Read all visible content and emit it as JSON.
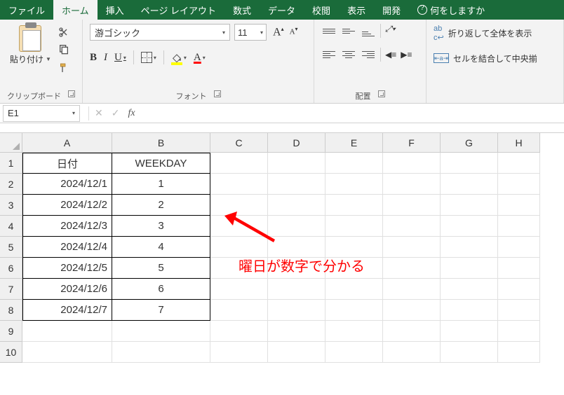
{
  "tabs": {
    "file": "ファイル",
    "home": "ホーム",
    "insert": "挿入",
    "layout": "ページ レイアウト",
    "formulas": "数式",
    "data": "データ",
    "review": "校閲",
    "view": "表示",
    "dev": "開発",
    "tell_me": "何をしますか"
  },
  "ribbon": {
    "clipboard": {
      "paste_label": "貼り付け",
      "group_label": "クリップボード"
    },
    "font": {
      "name": "游ゴシック",
      "size": "11",
      "aa_big": "A",
      "aa_small": "A",
      "bold": "B",
      "italic": "I",
      "underline": "U",
      "font_color_letter": "A",
      "group_label": "フォント"
    },
    "align": {
      "group_label": "配置"
    },
    "wrap": {
      "wrap_label": "折り返して全体を表示",
      "merge_label": "セルを結合して中央揃"
    }
  },
  "formula_bar": {
    "name_box": "E1",
    "cancel": "✕",
    "confirm": "✓",
    "fx": "fx",
    "value": ""
  },
  "columns": [
    "A",
    "B",
    "C",
    "D",
    "E",
    "F",
    "G",
    "H"
  ],
  "row_count": 10,
  "sheet": {
    "headers": {
      "a": "日付",
      "b": "WEEKDAY"
    },
    "rows": [
      {
        "date": "2024/12/1",
        "wd": "1"
      },
      {
        "date": "2024/12/2",
        "wd": "2"
      },
      {
        "date": "2024/12/3",
        "wd": "3"
      },
      {
        "date": "2024/12/4",
        "wd": "4"
      },
      {
        "date": "2024/12/5",
        "wd": "5"
      },
      {
        "date": "2024/12/6",
        "wd": "6"
      },
      {
        "date": "2024/12/7",
        "wd": "7"
      }
    ]
  },
  "annotation": "曜日が数字で分かる"
}
